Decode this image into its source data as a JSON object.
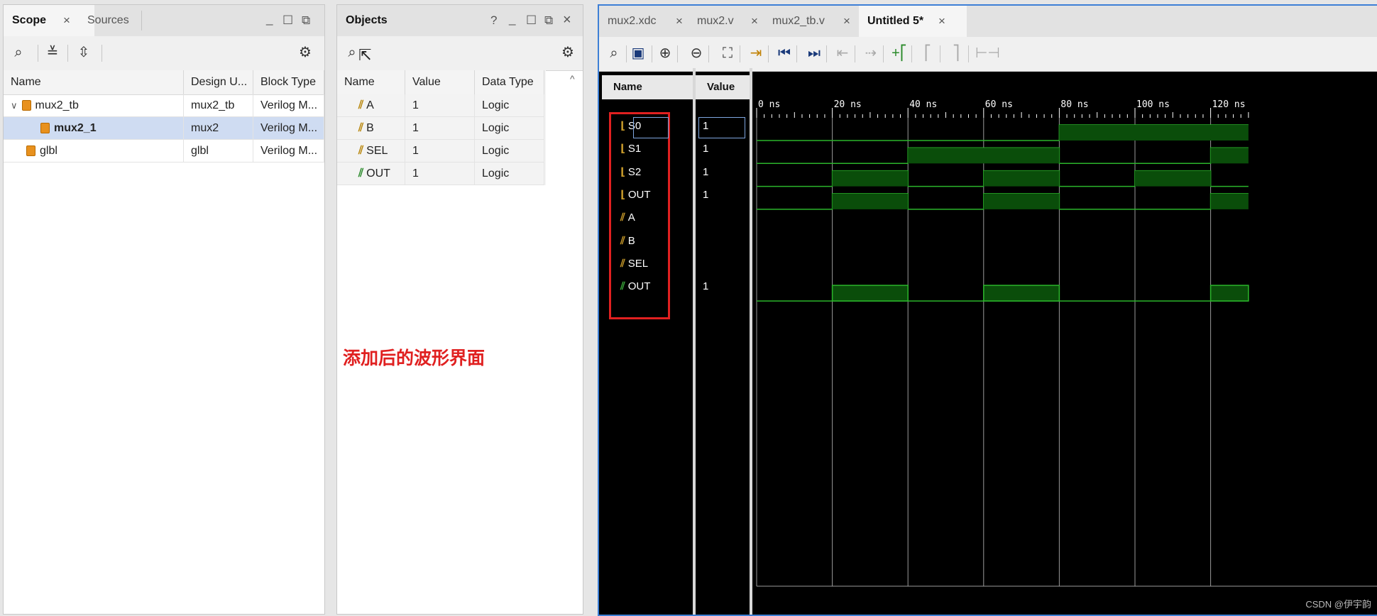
{
  "scope_panel": {
    "tabs": [
      "Scope",
      "Sources"
    ],
    "columns": [
      "Name",
      "Design U...",
      "Block Type"
    ],
    "rows": [
      {
        "name": "mux2_tb",
        "design": "mux2_tb",
        "block": "Verilog M..."
      },
      {
        "name": "mux2_1",
        "design": "mux2",
        "block": "Verilog M..."
      },
      {
        "name": "glbl",
        "design": "glbl",
        "block": "Verilog M..."
      }
    ]
  },
  "objects_panel": {
    "title": "Objects",
    "help": "?",
    "columns": [
      "Name",
      "Value",
      "Data Type"
    ],
    "rows": [
      {
        "name": "A",
        "value": "1",
        "type": "Logic"
      },
      {
        "name": "B",
        "value": "1",
        "type": "Logic"
      },
      {
        "name": "SEL",
        "value": "1",
        "type": "Logic"
      },
      {
        "name": "OUT",
        "value": "1",
        "type": "Logic"
      }
    ]
  },
  "annotation": "添加后的波形界面",
  "editor_tabs": [
    "mux2.xdc",
    "mux2.v",
    "mux2_tb.v",
    "Untitled 5*"
  ],
  "wave": {
    "name_header": "Name",
    "value_header": "Value",
    "signals": [
      {
        "name": "S0",
        "value": "1"
      },
      {
        "name": "S1",
        "value": "1"
      },
      {
        "name": "S2",
        "value": "1"
      },
      {
        "name": "OUT",
        "value": "1"
      },
      {
        "name": "A",
        "value": ""
      },
      {
        "name": "B",
        "value": ""
      },
      {
        "name": "SEL",
        "value": ""
      },
      {
        "name": "OUT",
        "value": "1"
      }
    ],
    "ticks": [
      "0 ns",
      "20 ns",
      "40 ns",
      "60 ns",
      "80 ns",
      "100 ns",
      "120 ns"
    ],
    "high_segments": [
      [
        [
          80,
          130
        ]
      ],
      [
        [
          40,
          80
        ],
        [
          120,
          130
        ]
      ],
      [
        [
          20,
          40
        ],
        [
          60,
          80
        ],
        [
          100,
          120
        ]
      ],
      [
        [
          20,
          40
        ],
        [
          60,
          80
        ],
        [
          120,
          130
        ]
      ],
      [],
      [],
      [],
      [
        [
          20,
          40
        ],
        [
          60,
          80
        ],
        [
          120,
          130
        ]
      ]
    ],
    "signal_type": [
      "bit",
      "bit",
      "bit",
      "bit",
      "bus",
      "bus",
      "bus",
      "bus"
    ]
  },
  "watermark": "CSDN @伊宇韵",
  "colors": {
    "wave_green": "#2bb52b",
    "wave_fill": "#0a4d0a",
    "highlight": "#e02020"
  }
}
